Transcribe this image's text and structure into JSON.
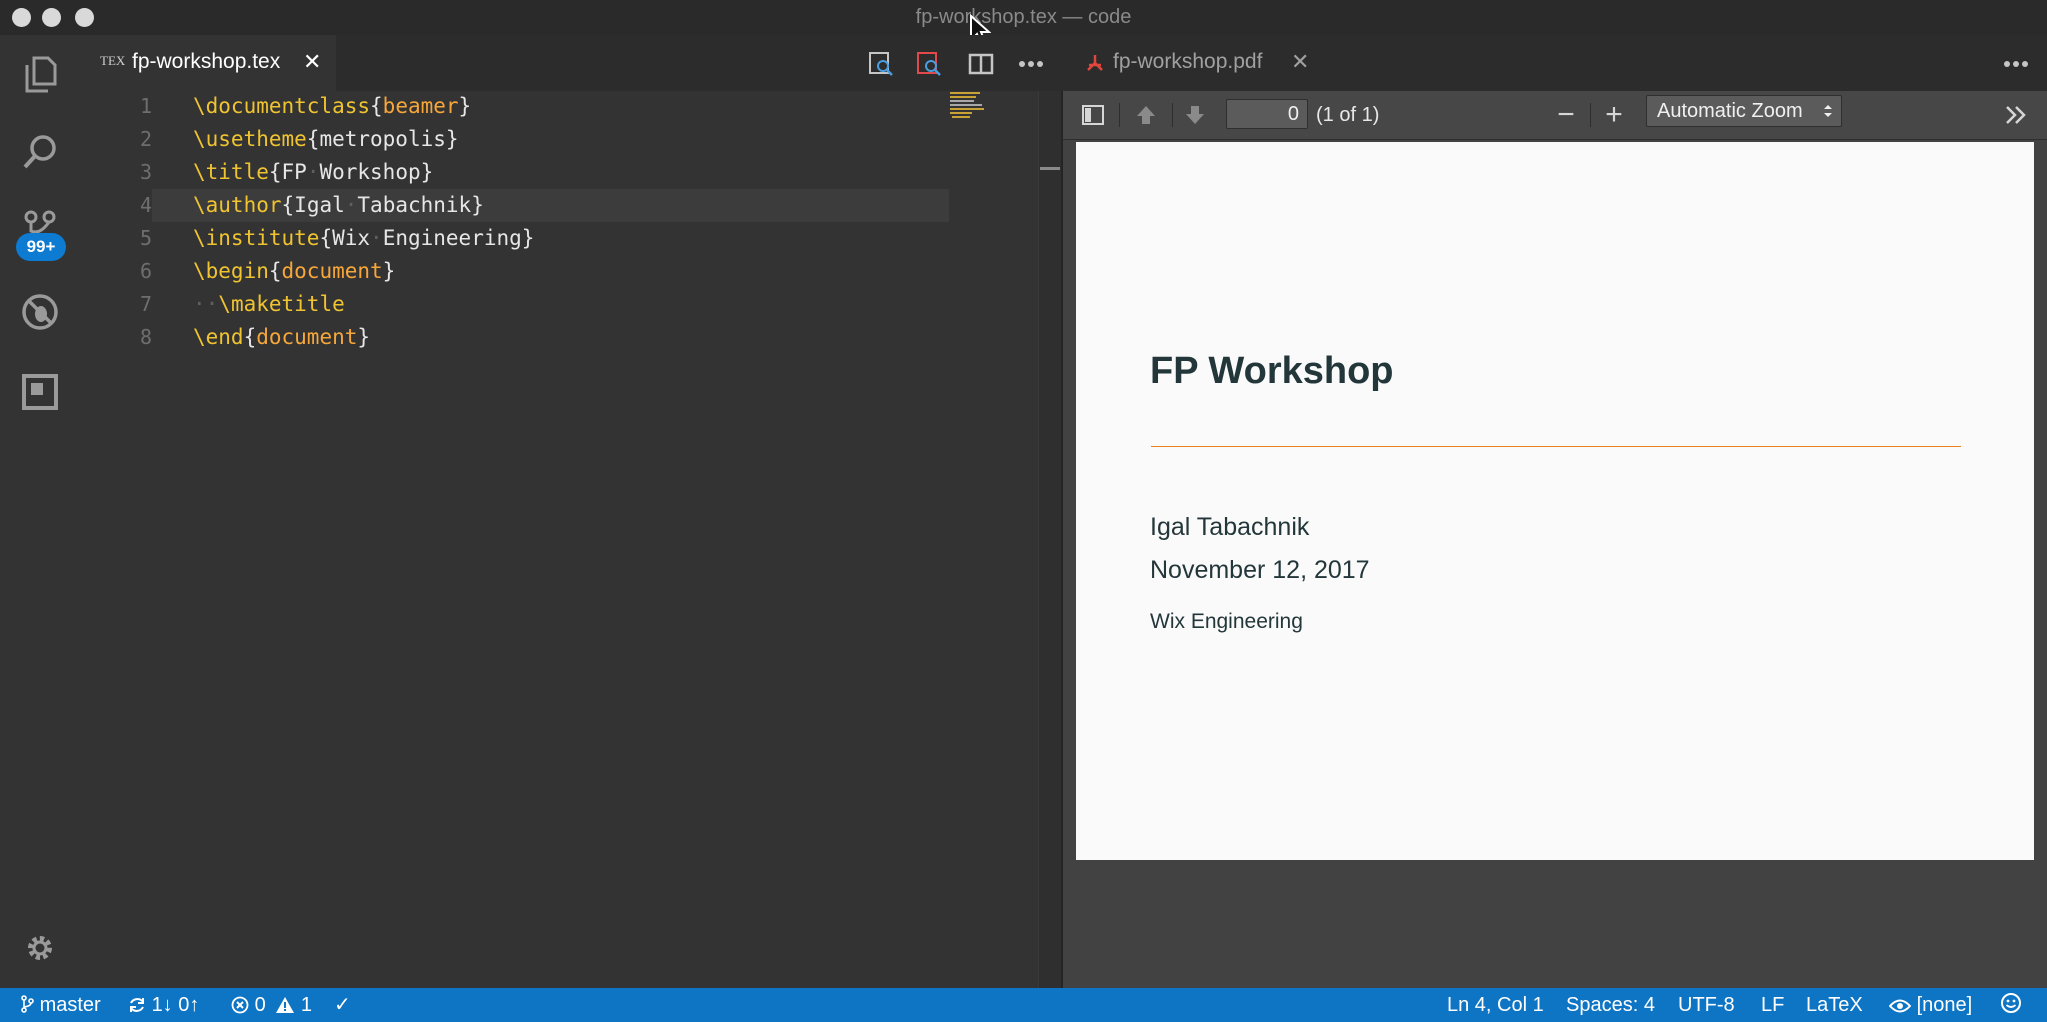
{
  "window": {
    "title": "fp-workshop.tex — code"
  },
  "activity_bar": {
    "items": [
      {
        "icon": "files-icon"
      },
      {
        "icon": "search-icon"
      },
      {
        "icon": "source-control-icon",
        "badge": "99+"
      },
      {
        "icon": "debug-icon"
      },
      {
        "icon": "extensions-icon"
      }
    ],
    "settings_icon": "gear-icon"
  },
  "editor": {
    "tab": {
      "label": "fp-workshop.tex",
      "icon": "TEX",
      "close": "✕"
    },
    "line_numbers": [
      "1",
      "2",
      "3",
      "4",
      "5",
      "6",
      "7",
      "8"
    ],
    "lines": [
      {
        "cmd": "\\documentclass",
        "open": "{",
        "arg": "beamer",
        "close": "}"
      },
      {
        "cmd": "\\usetheme",
        "open": "{",
        "arg": "metropolis",
        "close": "}"
      },
      {
        "cmd": "\\title",
        "open": "{",
        "arg": "FP",
        "ws": "·",
        "arg2": "Workshop",
        "close": "}"
      },
      {
        "cmd": "\\author",
        "open": "{",
        "arg": "Igal",
        "ws": "·",
        "arg2": "Tabachnik",
        "close": "}"
      },
      {
        "cmd": "\\institute",
        "open": "{",
        "arg": "Wix",
        "ws": "·",
        "arg2": "Engineering",
        "close": "}"
      },
      {
        "cmd": "\\begin",
        "open": "{",
        "arg": "document",
        "close": "}"
      },
      {
        "indent": "··",
        "cmd": "\\maketitle"
      },
      {
        "cmd": "\\end",
        "open": "{",
        "arg": "document",
        "close": "}"
      }
    ]
  },
  "pdf_viewer": {
    "tab": {
      "label": "fp-workshop.pdf",
      "close": "✕"
    },
    "page_value": "0",
    "page_of": "(1 of 1)",
    "zoom_label": "Automatic Zoom",
    "zoom_minus": "−",
    "zoom_plus": "+",
    "slide": {
      "title": "FP Workshop",
      "author": "Igal Tabachnik",
      "date": "November 12, 2017",
      "institute": "Wix Engineering"
    }
  },
  "status_bar": {
    "branch": "master",
    "sync": "1↓ 0↑",
    "errors": "0",
    "warnings": "1",
    "check": "✓",
    "position": "Ln 4, Col 1",
    "spaces": "Spaces: 4",
    "encoding": "UTF-8",
    "eol": "LF",
    "language": "LaTeX",
    "preview": "[none]"
  },
  "colors": {
    "statusbar_bg": "#0e75c5",
    "latex_command": "#f0c430",
    "latex_argument": "#f7a73a",
    "slide_rule": "#eb811b",
    "slide_text": "#23373b"
  }
}
